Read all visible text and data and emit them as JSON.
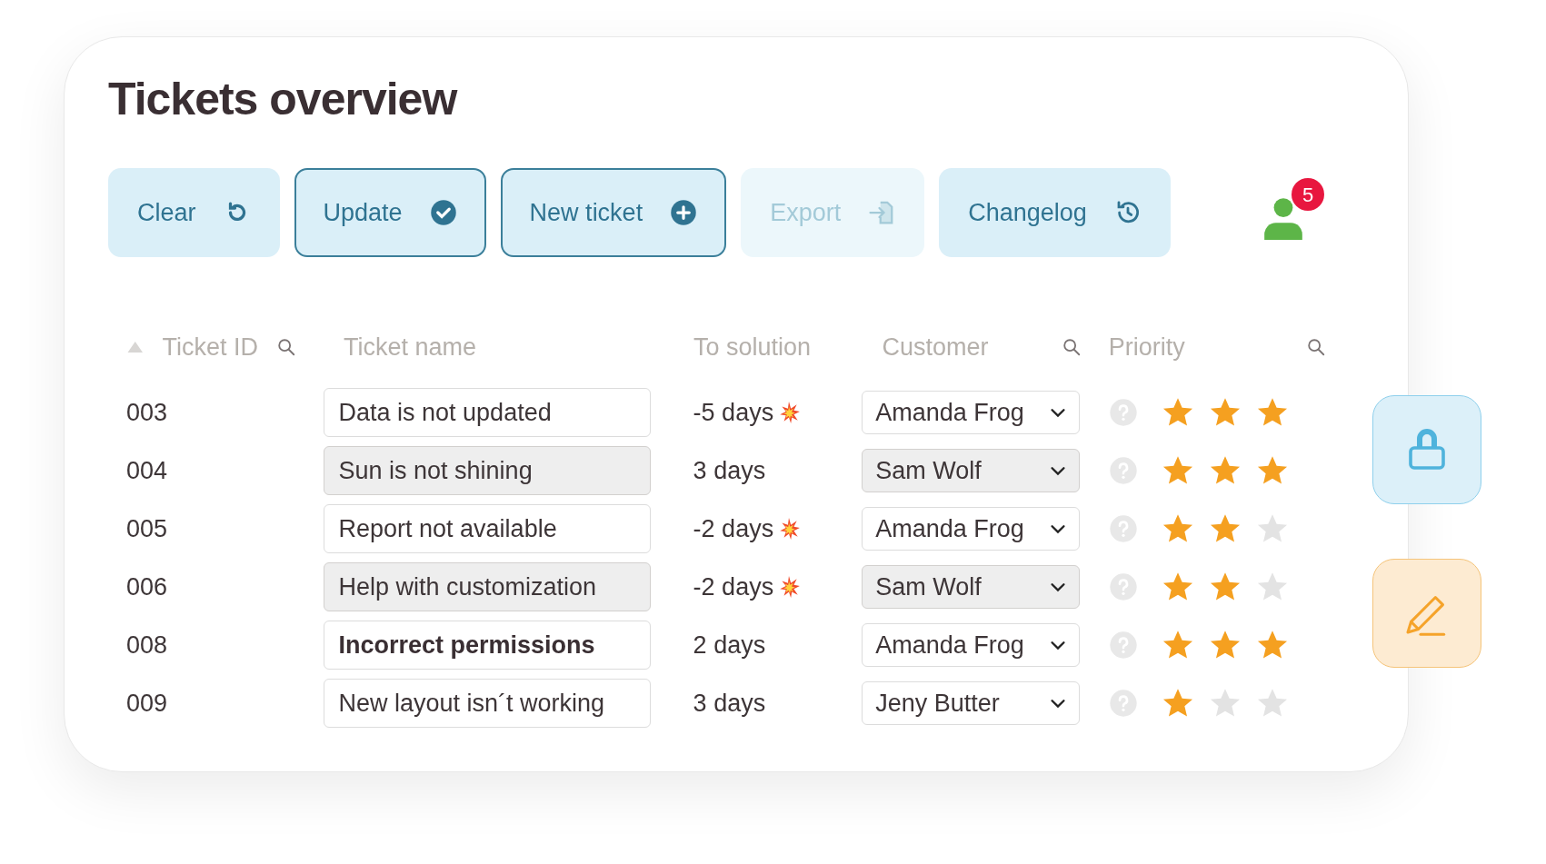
{
  "title": "Tickets overview",
  "toolbar": [
    {
      "label": "Clear",
      "outlined": false,
      "disabled": false
    },
    {
      "label": "Update",
      "outlined": true,
      "disabled": false
    },
    {
      "label": "New ticket",
      "outlined": true,
      "disabled": false
    },
    {
      "label": "Export",
      "outlined": false,
      "disabled": true
    },
    {
      "label": "Changelog",
      "outlined": false,
      "disabled": false
    }
  ],
  "notifications": {
    "count": "5"
  },
  "table": {
    "columns": [
      {
        "label": "Ticket ID",
        "sortable": true,
        "searchable": true
      },
      {
        "label": "Ticket name",
        "sortable": false,
        "searchable": false
      },
      {
        "label": "To solution",
        "sortable": false,
        "searchable": false
      },
      {
        "label": "Customer",
        "sortable": false,
        "searchable": true
      },
      {
        "label": "Priority",
        "sortable": false,
        "searchable": true
      }
    ],
    "rows": [
      {
        "id": "003",
        "name": "Data is not updated",
        "solution": "-5 days",
        "overdue": true,
        "customer": "Amanda Frog",
        "shaded": false,
        "bold": false,
        "stars": 3
      },
      {
        "id": "004",
        "name": "Sun is not shining",
        "solution": "3 days",
        "overdue": false,
        "customer": "Sam Wolf",
        "shaded": true,
        "bold": false,
        "stars": 3
      },
      {
        "id": "005",
        "name": "Report not available",
        "solution": "-2 days",
        "overdue": true,
        "customer": "Amanda Frog",
        "shaded": false,
        "bold": false,
        "stars": 2
      },
      {
        "id": "006",
        "name": "Help with customization",
        "solution": "-2 days",
        "overdue": true,
        "customer": "Sam Wolf",
        "shaded": true,
        "bold": false,
        "stars": 2
      },
      {
        "id": "008",
        "name": "Incorrect permissions",
        "solution": "2 days",
        "overdue": false,
        "customer": "Amanda Frog",
        "shaded": false,
        "bold": true,
        "stars": 3
      },
      {
        "id": "009",
        "name": "New layout isn´t working",
        "solution": "3 days",
        "overdue": false,
        "customer": "Jeny Butter",
        "shaded": false,
        "bold": false,
        "stars": 1
      }
    ]
  }
}
